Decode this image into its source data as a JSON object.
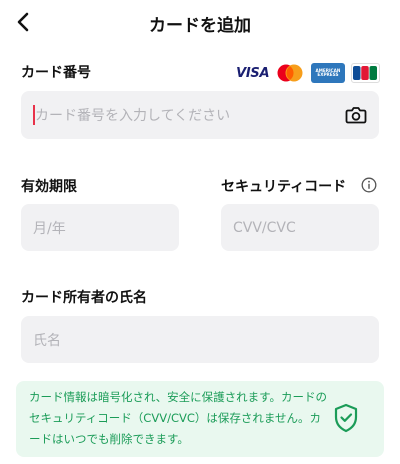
{
  "header": {
    "title": "カードを追加",
    "back_icon": "chevron-left-icon"
  },
  "card_number": {
    "label": "カード番号",
    "placeholder": "カード番号を入力してください",
    "brands": [
      "VISA",
      "Mastercard",
      "AMERICAN EXPRESS",
      "JCB"
    ],
    "camera_icon": "camera-icon"
  },
  "expiry": {
    "label": "有効期限",
    "placeholder": "月/年"
  },
  "cvv": {
    "label": "セキュリティコード",
    "placeholder": "CVV/CVC",
    "info_icon": "info-icon"
  },
  "holder": {
    "label": "カード所有者の氏名",
    "placeholder": "氏名"
  },
  "notice": {
    "text": "カード情報は暗号化され、安全に保護されます。カードのセキュリティコード（CVV/CVC）は保存されません。カードはいつでも削除できます。",
    "icon": "shield-check-icon"
  },
  "colors": {
    "accent_green": "#1b9c58",
    "notice_bg": "#e9f8ef",
    "field_bg": "#f1f1f3",
    "caret": "#e8324a"
  }
}
